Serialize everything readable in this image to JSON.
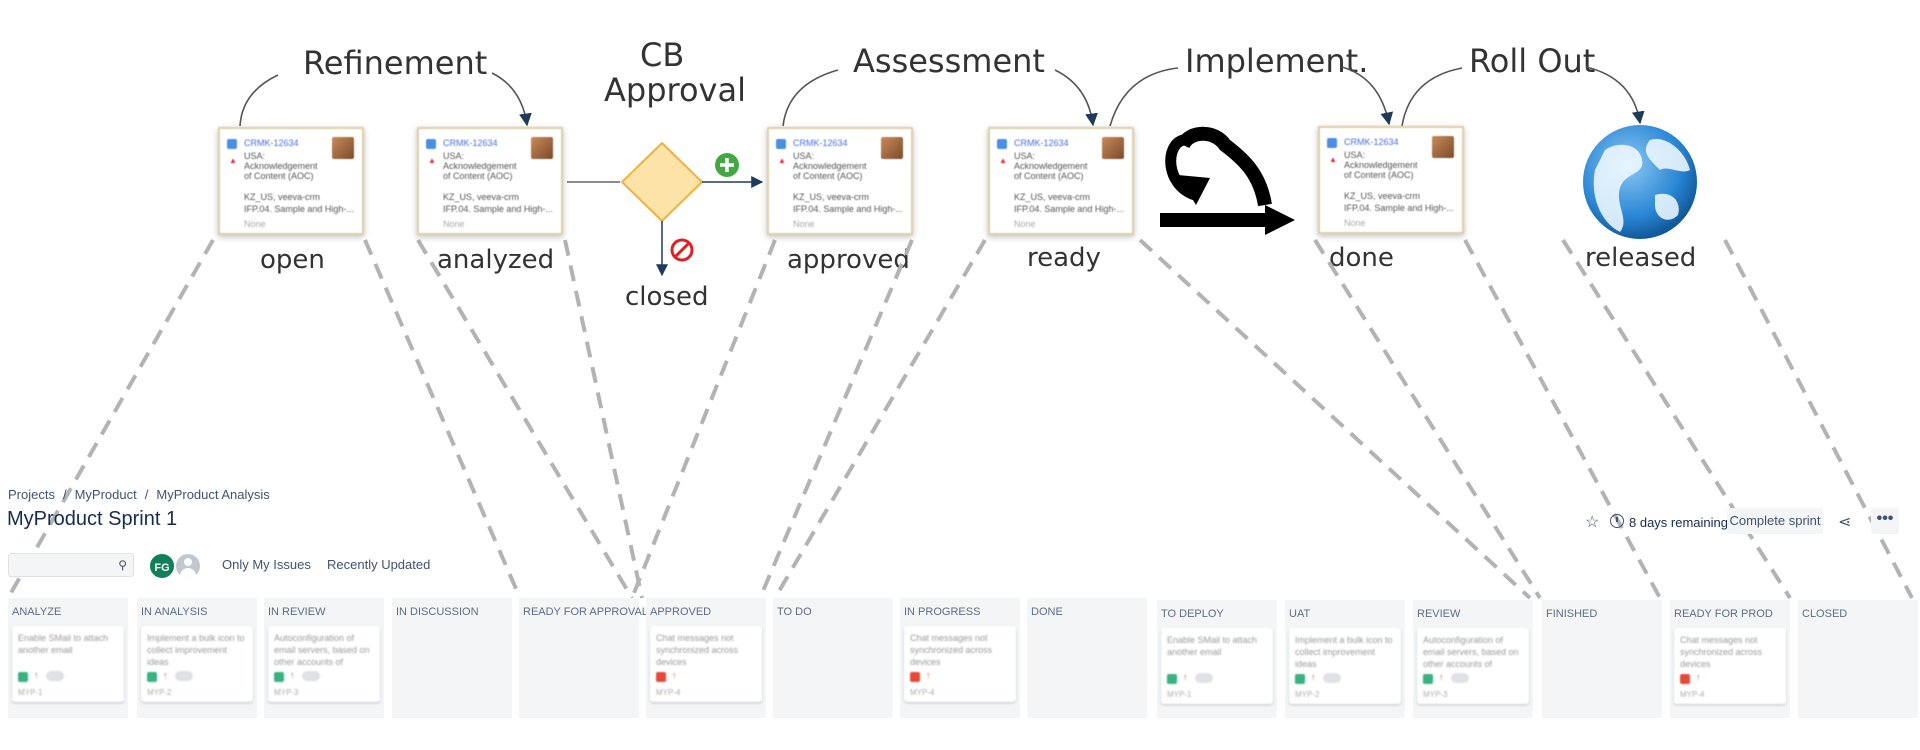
{
  "diagram": {
    "phases": {
      "refinement": "Refinement",
      "cb_approval_line1": "CB",
      "cb_approval_line2": "Approval",
      "assessment": "Assessment",
      "implement": "Implement.",
      "rollout": "Roll Out"
    },
    "statuses": {
      "open": "open",
      "analyzed": "analyzed",
      "closed": "closed",
      "approved": "approved",
      "ready": "ready",
      "done": "done",
      "released": "released"
    },
    "card": {
      "key": "CRMK-12634",
      "title_lines": [
        "USA:",
        "Acknowledgement",
        "of Content (AOC)"
      ],
      "meta_lines": [
        "KZ_US, veeva-crm",
        "IFP.04. Sample and High-..."
      ],
      "none_label": "None"
    },
    "colors": {
      "decision": "#fde3a7",
      "approve": "#43a843",
      "reject": "#e02020",
      "globe": "#2a86d4"
    }
  },
  "board": {
    "breadcrumb": [
      "Projects",
      "MyProduct",
      "MyProduct Analysis"
    ],
    "title": "MyProduct Sprint 1",
    "avatar_initials": "FG",
    "quick_filters": [
      "Only My Issues",
      "Recently Updated"
    ],
    "days_remaining": "8 days remaining",
    "complete_sprint": "Complete sprint",
    "more": "•••",
    "columns": [
      {
        "name": "ANALYZE",
        "card": {
          "text": "Enable SMail to attach another email",
          "color": "green",
          "key": "MYP-1"
        }
      },
      {
        "name": "IN ANALYSIS",
        "card": {
          "text": "Implement a bulk icon to collect improvement ideas",
          "color": "green",
          "key": "MYP-2"
        }
      },
      {
        "name": "IN REVIEW",
        "card": {
          "text": "Autoconfiguration of email servers, based on other accounts of",
          "color": "green",
          "key": "MYP-3"
        }
      },
      {
        "name": "IN DISCUSSION",
        "card": null
      },
      {
        "name": "READY FOR APPROVAL",
        "card": null
      },
      {
        "name": "APPROVED",
        "card": {
          "text": "Chat messages not synchronized across devices",
          "color": "red",
          "key": "MYP-4"
        }
      },
      {
        "name": "TO DO",
        "card": null
      },
      {
        "name": "IN PROGRESS",
        "card": {
          "text": "Chat messages not synchronized across devices",
          "color": "red",
          "key": "MYP-4"
        }
      },
      {
        "name": "DONE",
        "card": null
      },
      {
        "name": "TO DEPLOY",
        "card": {
          "text": "Enable SMail to attach another email",
          "color": "green",
          "key": "MYP-1"
        }
      },
      {
        "name": "UAT",
        "card": {
          "text": "Implement a bulk icon to collect improvement ideas",
          "color": "green",
          "key": "MYP-2"
        }
      },
      {
        "name": "REVIEW",
        "card": {
          "text": "Autoconfiguration of email servers, based on other accounts of",
          "color": "green",
          "key": "MYP-3"
        }
      },
      {
        "name": "FINISHED",
        "card": null
      },
      {
        "name": "READY FOR PROD",
        "card": {
          "text": "Chat messages not synchronized across devices",
          "color": "red",
          "key": "MYP-4"
        }
      },
      {
        "name": "CLOSED",
        "card": null
      }
    ]
  }
}
